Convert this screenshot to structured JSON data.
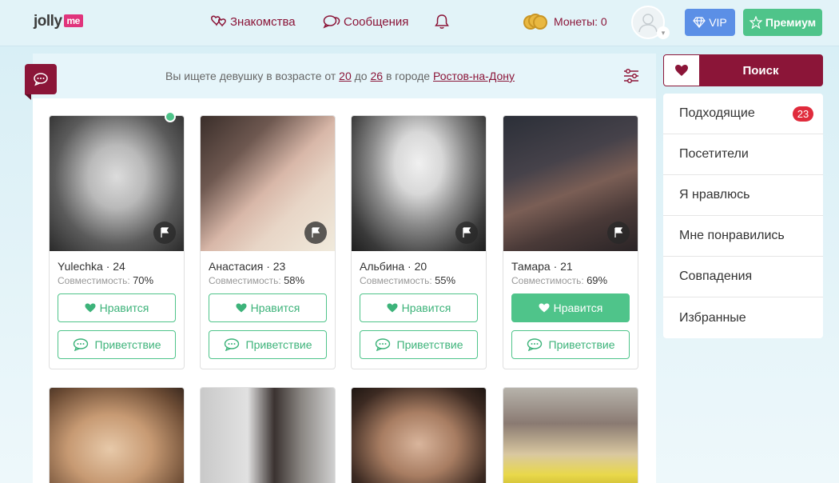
{
  "header": {
    "logo_text": "jolly",
    "logo_suffix": "me",
    "nav": {
      "dating": "Знакомства",
      "messages": "Сообщения"
    },
    "coins_label": "Монеты: 0",
    "vip_label": "VIP",
    "premium_label": "Премиум"
  },
  "search": {
    "prefix": "Вы ищете девушку в возрасте от",
    "age_from": "20",
    "between": "до",
    "age_to": "26",
    "city_prefix": "в городе",
    "city": "Ростов-на-Дону"
  },
  "cards": [
    {
      "name": "Yulechka · 24",
      "compat_label": "Совместимость:",
      "compat": "70%",
      "like": "Нравится",
      "greet": "Приветствие",
      "online": true,
      "liked": false
    },
    {
      "name": "Анастасия · 23",
      "compat_label": "Совместимость:",
      "compat": "58%",
      "like": "Нравится",
      "greet": "Приветствие",
      "online": false,
      "liked": false
    },
    {
      "name": "Альбина · 20",
      "compat_label": "Совместимость:",
      "compat": "55%",
      "like": "Нравится",
      "greet": "Приветствие",
      "online": false,
      "liked": false
    },
    {
      "name": "Тамара · 21",
      "compat_label": "Совместимость:",
      "compat": "69%",
      "like": "Нравится",
      "greet": "Приветствие",
      "online": false,
      "liked": true
    }
  ],
  "sidebar": {
    "search_label": "Поиск",
    "menu": [
      {
        "label": "Подходящие",
        "badge": "23"
      },
      {
        "label": "Посетители"
      },
      {
        "label": "Я нравлюсь"
      },
      {
        "label": "Мне понравились"
      },
      {
        "label": "Совпадения"
      },
      {
        "label": "Избранные"
      }
    ]
  },
  "colors": {
    "brand": "#8b1538",
    "accent_green": "#4fc48a",
    "vip_blue": "#5b8fe6",
    "badge_red": "#e02b3c"
  }
}
